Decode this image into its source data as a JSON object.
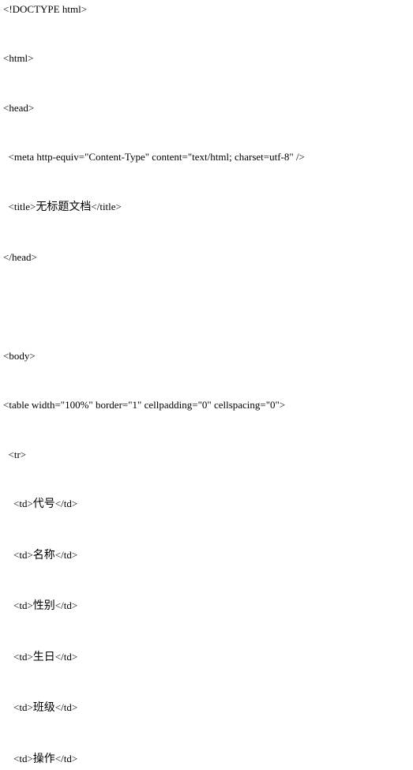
{
  "lines": {
    "l1": "<!DOCTYPE html>",
    "l2": "<html>",
    "l3": "<head>",
    "l4_a": "  <meta http-equiv=\"Content-Type\" content=\"text/html; charset=utf-8\" />",
    "l5_a": "  <title>",
    "l5_b": "无标题文档",
    "l5_c": "</title>",
    "l6": "</head>",
    "l7": "<body>",
    "l8": "<table width=\"100%\" border=\"1\" cellpadding=\"0\" cellspacing=\"0\">",
    "l9": "  <tr>",
    "l10_a": "    <td>",
    "l10_b": "代号",
    "l10_c": "</td>",
    "l11_a": "    <td>",
    "l11_b": "名称",
    "l11_c": "</td>",
    "l12_a": "    <td>",
    "l12_b": "性别",
    "l12_c": "</td>",
    "l13_a": "    <td>",
    "l13_b": "生日",
    "l13_c": "</td>",
    "l14_a": "    <td>",
    "l14_b": "班级",
    "l14_c": "</td>",
    "l15_a": "    <td>",
    "l15_b": "操作",
    "l15_c": "</td>"
  },
  "spacing": {
    "gap_small": " ",
    "gap_large": " "
  }
}
